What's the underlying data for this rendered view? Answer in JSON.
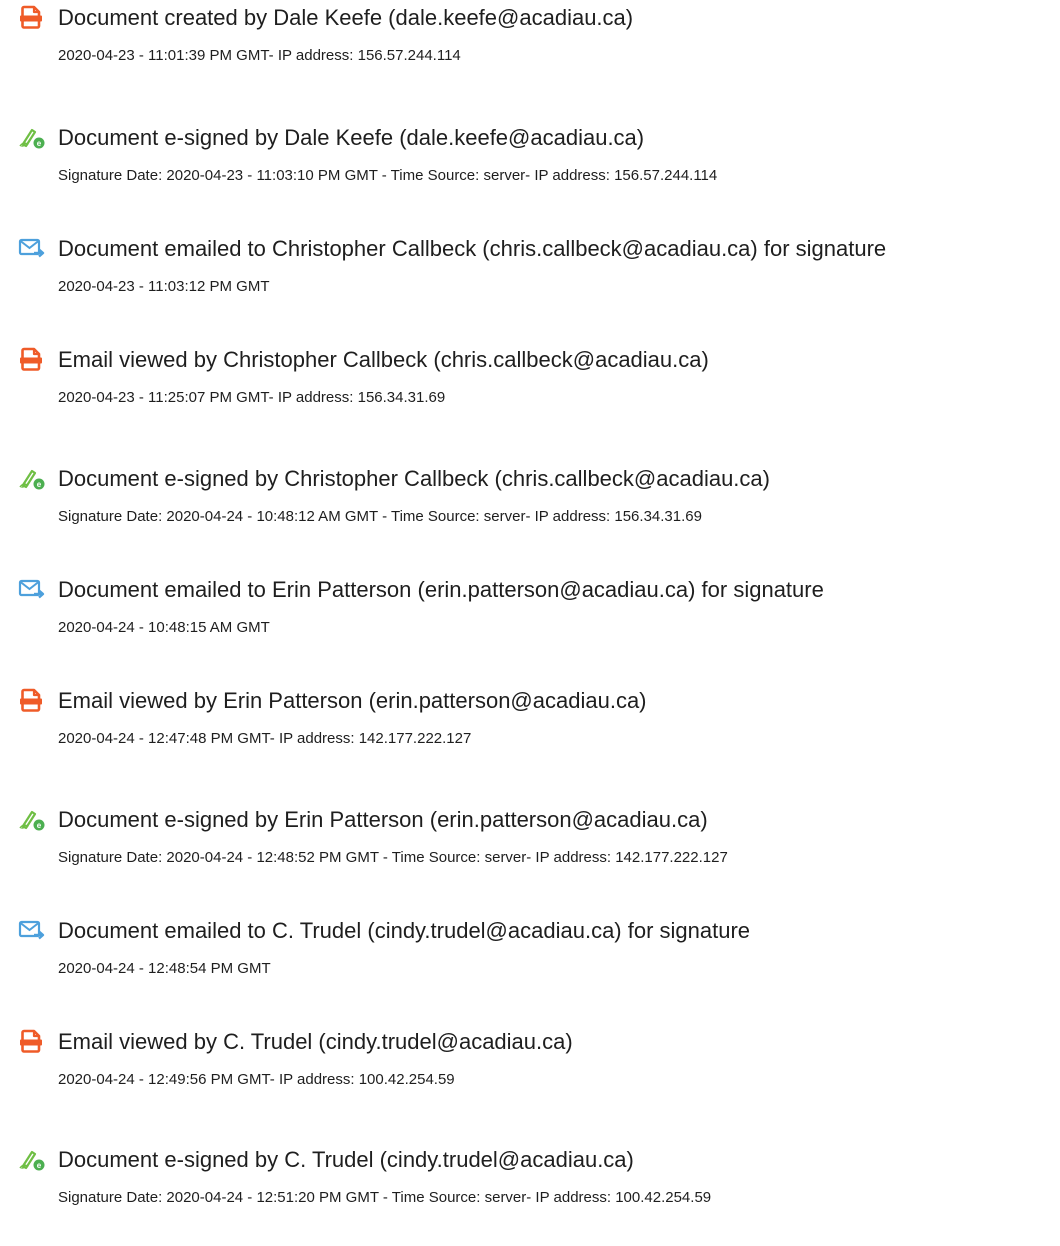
{
  "events": [
    {
      "icon": "document-icon",
      "title": "Document created by Dale Keefe (dale.keefe@acadiau.ca)",
      "detail": "2020-04-23 - 11:01:39 PM GMT- IP address: 156.57.244.114"
    },
    {
      "icon": "esign-pen-icon",
      "title": "Document e-signed by Dale Keefe (dale.keefe@acadiau.ca)",
      "detail": "Signature Date: 2020-04-23 - 11:03:10 PM GMT - Time Source: server- IP address: 156.57.244.114"
    },
    {
      "icon": "email-send-icon",
      "title": "Document emailed to Christopher Callbeck (chris.callbeck@acadiau.ca) for signature",
      "detail": "2020-04-23 - 11:03:12 PM GMT"
    },
    {
      "icon": "document-icon",
      "title": "Email viewed by Christopher Callbeck (chris.callbeck@acadiau.ca)",
      "detail": "2020-04-23 - 11:25:07 PM GMT- IP address: 156.34.31.69"
    },
    {
      "icon": "esign-pen-icon",
      "title": "Document e-signed by Christopher Callbeck (chris.callbeck@acadiau.ca)",
      "detail": "Signature Date: 2020-04-24 - 10:48:12 AM GMT - Time Source: server- IP address: 156.34.31.69"
    },
    {
      "icon": "email-send-icon",
      "title": "Document emailed to Erin Patterson (erin.patterson@acadiau.ca) for signature",
      "detail": "2020-04-24 - 10:48:15 AM GMT"
    },
    {
      "icon": "document-icon",
      "title": "Email viewed by Erin Patterson (erin.patterson@acadiau.ca)",
      "detail": "2020-04-24 - 12:47:48 PM GMT- IP address: 142.177.222.127"
    },
    {
      "icon": "esign-pen-icon",
      "title": "Document e-signed by Erin Patterson (erin.patterson@acadiau.ca)",
      "detail": "Signature Date: 2020-04-24 - 12:48:52 PM GMT - Time Source: server- IP address: 142.177.222.127"
    },
    {
      "icon": "email-send-icon",
      "title": "Document emailed to C. Trudel (cindy.trudel@acadiau.ca) for signature",
      "detail": "2020-04-24 - 12:48:54 PM GMT"
    },
    {
      "icon": "document-icon",
      "title": "Email viewed by C. Trudel (cindy.trudel@acadiau.ca)",
      "detail": "2020-04-24 - 12:49:56 PM GMT- IP address: 100.42.254.59"
    },
    {
      "icon": "esign-pen-icon",
      "title": "Document e-signed by C. Trudel (cindy.trudel@acadiau.ca)",
      "detail": "Signature Date: 2020-04-24 - 12:51:20 PM GMT - Time Source: server- IP address: 100.42.254.59"
    }
  ],
  "colors": {
    "document_icon": "#ef5b28",
    "esign_pen_icon": "#6fbf44",
    "email_icon": "#4da0dc"
  }
}
